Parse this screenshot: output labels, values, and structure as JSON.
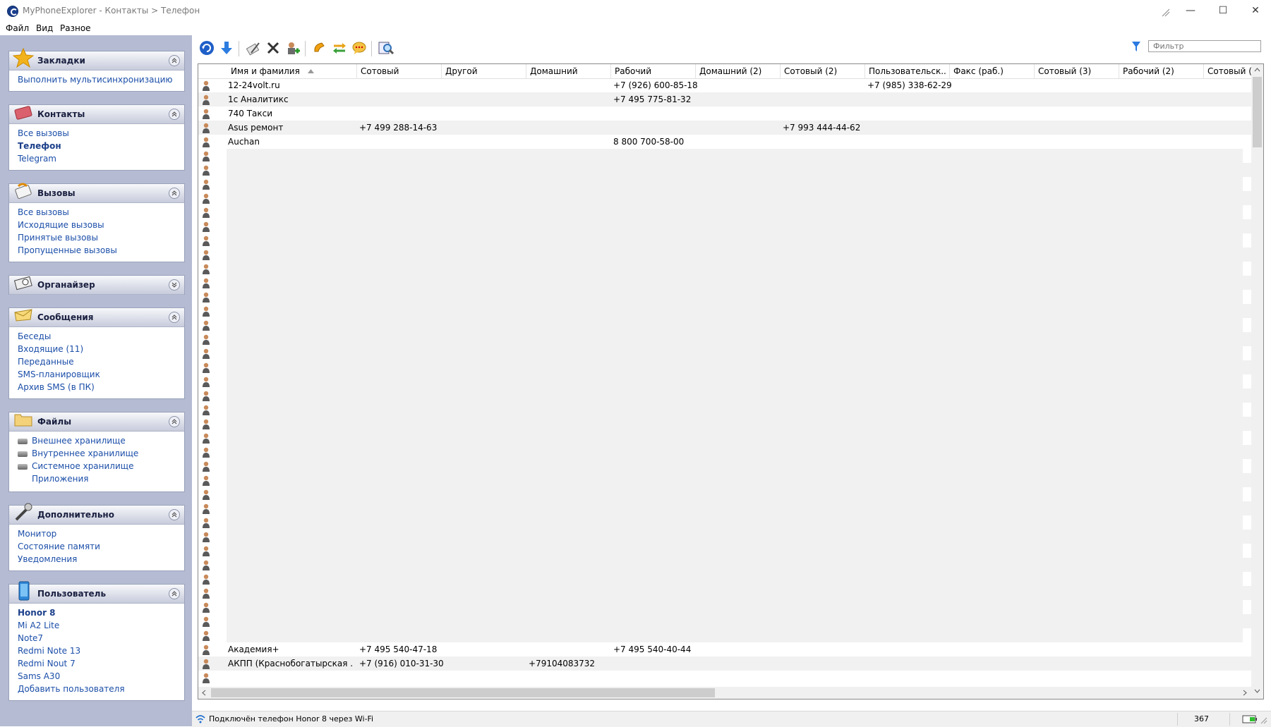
{
  "window": {
    "title": "MyPhoneExplorer -  Контакты > Телефон",
    "minimize": "—",
    "maximize": "☐",
    "close": "✕"
  },
  "menu": [
    "Файл",
    "Вид",
    "Разное"
  ],
  "sidebar": {
    "bookmarks": {
      "title": "Закладки",
      "items": [
        "Выполнить мультисинхронизацию"
      ]
    },
    "contacts": {
      "title": "Контакты",
      "items": [
        "Все вызовы",
        "Телефон",
        "Telegram"
      ],
      "active": "Телефон"
    },
    "calls": {
      "title": "Вызовы",
      "items": [
        "Все вызовы",
        "Исходящие вызовы",
        "Принятые вызовы",
        "Пропущенные вызовы"
      ]
    },
    "organizer": {
      "title": "Органайзер"
    },
    "messages": {
      "title": "Сообщения",
      "items": [
        "Беседы",
        "Входящие (11)",
        "Переданные",
        "SMS-планировщик",
        "Архив SMS (в ПК)"
      ]
    },
    "files": {
      "title": "Файлы",
      "items": [
        "Внешнее хранилище",
        "Внутреннее хранилище",
        "Системное хранилище",
        "Приложения"
      ]
    },
    "extra": {
      "title": "Дополнительно",
      "items": [
        "Монитор",
        "Состояние памяти",
        "Уведомления"
      ]
    },
    "user": {
      "title": "Пользователь",
      "items": [
        "Honor 8",
        "Mi A2 Lite",
        "Note7",
        "Redmi Note 13",
        "Redmi Nout 7",
        "Sams A30",
        "Добавить пользователя"
      ],
      "active": "Honor 8"
    }
  },
  "toolbar": {
    "icons": [
      "refresh-icon",
      "download-icon",
      "edit-icon",
      "delete-icon",
      "add-contact-icon",
      "call-icon",
      "sync-icon",
      "message-icon",
      "search-contacts-icon"
    ],
    "filter_placeholder": "Фильтр"
  },
  "table": {
    "columns": [
      "Имя и фамилия",
      "Сотовый",
      "Другой",
      "Домашний",
      "Рабочий",
      "Домашний (2)",
      "Сотовый (2)",
      "Пользовательск...",
      "Факс (раб.)",
      "Сотовый (3)",
      "Рабочий (2)",
      "Сотовый ("
    ],
    "rows_top": [
      {
        "name": "12-24volt.ru",
        "work": "+7 (926) 600-85-18",
        "custom": "+7 (985) 338-62-29"
      },
      {
        "name": "1c Аналитикс",
        "work": "+7 495 775-81-32"
      },
      {
        "name": "740 Такси"
      },
      {
        "name": "Asus ремонт",
        "mobile": "+7 499 288-14-63",
        "mobile2": "+7 993 444-44-62"
      },
      {
        "name": "Auchan",
        "work": "8 800 700-58-00"
      }
    ],
    "rows_bottom": [
      {
        "name": "Академия+",
        "mobile": "+7 495 540-47-18",
        "work": "+7 495 540-40-44"
      },
      {
        "name": "АКПП (Краснобогатырская ...",
        "mobile": "+7 (916) 010-31-30",
        "home": "+79104083732"
      }
    ]
  },
  "status": {
    "text": "Подключён телефон Honor 8 через Wi-Fi",
    "count": "367"
  },
  "colors": {
    "sidebar_bg": "#b4bbd2",
    "link": "#1b4ea8",
    "row_alt": "#f1f1f1"
  }
}
